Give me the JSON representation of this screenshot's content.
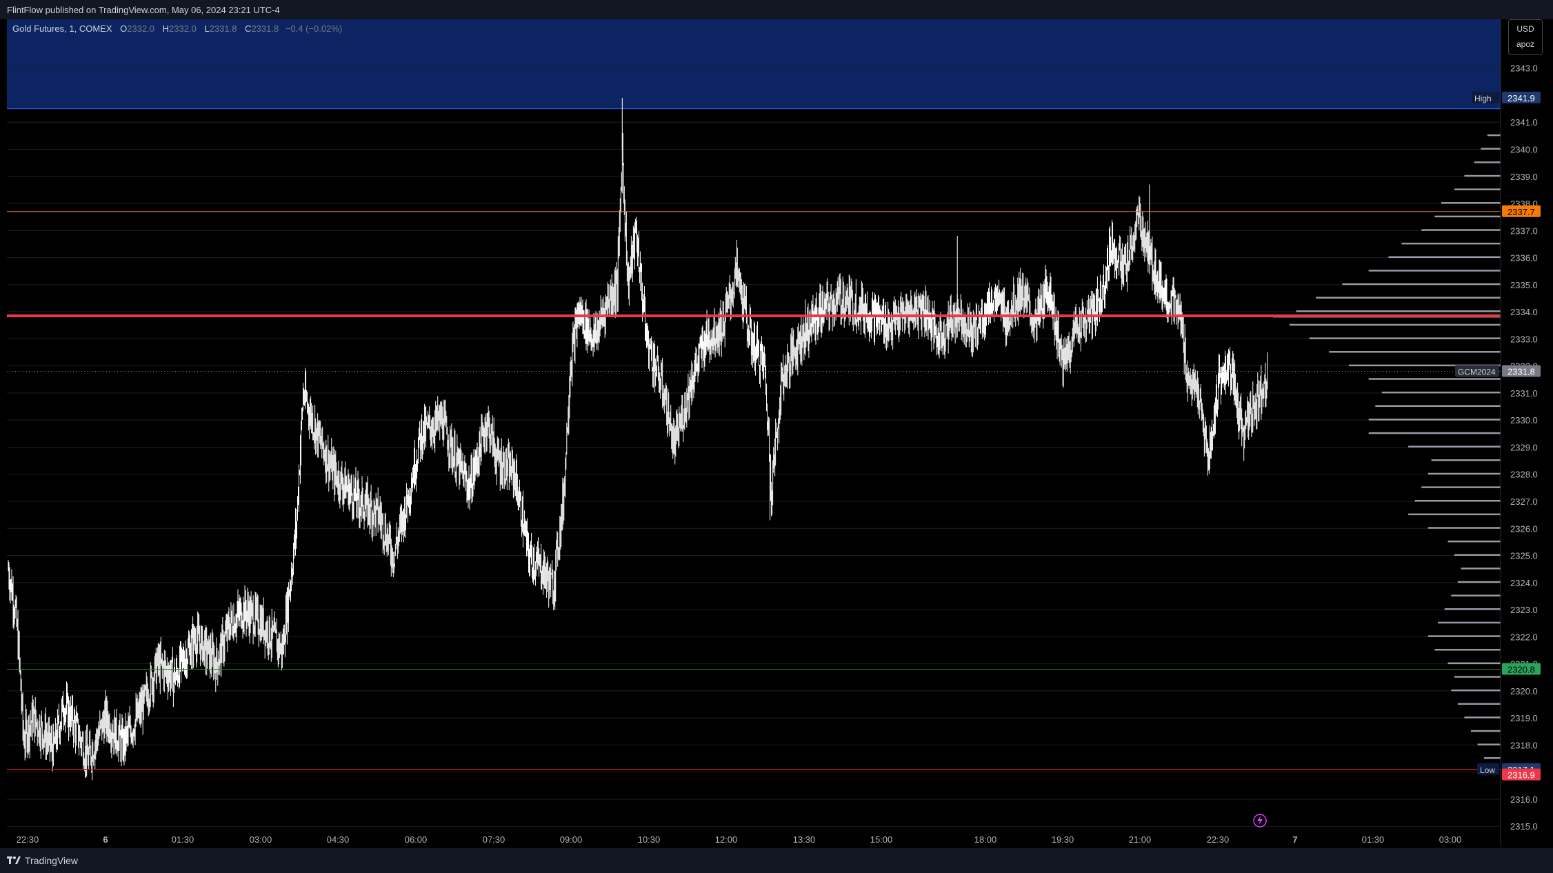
{
  "header": {
    "publish_line": "FlintFlow published on TradingView.com, May 06, 2024 23:21 UTC-4"
  },
  "legend": {
    "symbol": "Gold Futures, 1, COMEX",
    "open_label": "O",
    "open": "2332.0",
    "high_label": "H",
    "high": "2332.0",
    "low_label": "L",
    "low": "2331.8",
    "close_label": "C",
    "close": "2331.8",
    "change": "−0.4 (−0.02%)"
  },
  "scale_box": {
    "currency": "USD",
    "mode": "apoz"
  },
  "footer": {
    "brand": "TradingView"
  },
  "colors": {
    "background": "#000000",
    "premium_zone": "#0c2461",
    "premium_zone_border": "#2962ff",
    "poc_line": "#f23645",
    "upper_level": "#f57c00",
    "lower_level": "#2e7d32",
    "low_level": "#b71c1c",
    "candles": "#ffffff",
    "profile": "#b2b5be"
  },
  "icons": {
    "event_marker": "lightning-icon",
    "brand_logo": "tv-logo-icon"
  },
  "chart_data": {
    "type": "candlestick",
    "instrument": "Gold Futures",
    "timeframe": "1",
    "exchange": "COMEX",
    "ylim": [
      2314.7,
      2344.8
    ],
    "y_ticks": [
      "2315.0",
      "2316.0",
      "2317.0",
      "2318.0",
      "2319.0",
      "2320.0",
      "2321.0",
      "2322.0",
      "2323.0",
      "2324.0",
      "2325.0",
      "2326.0",
      "2327.0",
      "2328.0",
      "2329.0",
      "2330.0",
      "2331.0",
      "2332.0",
      "2333.0",
      "2334.0",
      "2335.0",
      "2336.0",
      "2337.0",
      "2338.0",
      "2339.0",
      "2340.0",
      "2341.0",
      "2343.0"
    ],
    "x_ticks": [
      "22:30",
      "6",
      "01:30",
      "03:00",
      "04:30",
      "06:00",
      "07:30",
      "09:00",
      "10:30",
      "12:00",
      "13:30",
      "15:00",
      "18:00",
      "19:30",
      "21:00",
      "22:30",
      "7",
      "01:30",
      "03:00"
    ],
    "price_path": [
      [
        0,
        2324.5
      ],
      [
        10,
        2323.0
      ],
      [
        15,
        2321.5
      ],
      [
        22,
        2318.2
      ],
      [
        35,
        2319.0
      ],
      [
        50,
        2318.5
      ],
      [
        65,
        2317.8
      ],
      [
        80,
        2319.5
      ],
      [
        95,
        2318.8
      ],
      [
        115,
        2317.5
      ],
      [
        140,
        2319.0
      ],
      [
        165,
        2318.0
      ],
      [
        195,
        2319.5
      ],
      [
        215,
        2321.0
      ],
      [
        240,
        2320.5
      ],
      [
        270,
        2322.0
      ],
      [
        300,
        2321.0
      ],
      [
        320,
        2322.5
      ],
      [
        340,
        2323.0
      ],
      [
        365,
        2322.5
      ],
      [
        395,
        2321.5
      ],
      [
        415,
        2326.0
      ],
      [
        425,
        2331.0
      ],
      [
        445,
        2329.5
      ],
      [
        470,
        2328.0
      ],
      [
        505,
        2327.0
      ],
      [
        535,
        2326.5
      ],
      [
        555,
        2325.0
      ],
      [
        575,
        2327.0
      ],
      [
        595,
        2329.5
      ],
      [
        625,
        2330.0
      ],
      [
        645,
        2328.5
      ],
      [
        665,
        2327.5
      ],
      [
        690,
        2330.0
      ],
      [
        705,
        2328.5
      ],
      [
        730,
        2328.0
      ],
      [
        750,
        2325.0
      ],
      [
        770,
        2324.5
      ],
      [
        785,
        2323.8
      ],
      [
        800,
        2327.0
      ],
      [
        810,
        2332.0
      ],
      [
        822,
        2334.0
      ],
      [
        845,
        2333.0
      ],
      [
        865,
        2334.5
      ],
      [
        878,
        2335.0
      ],
      [
        885,
        2340.0
      ],
      [
        893,
        2335.0
      ],
      [
        905,
        2337.0
      ],
      [
        920,
        2333.0
      ],
      [
        945,
        2331.0
      ],
      [
        960,
        2329.0
      ],
      [
        985,
        2331.5
      ],
      [
        1005,
        2333.0
      ],
      [
        1030,
        2333.5
      ],
      [
        1050,
        2335.5
      ],
      [
        1070,
        2333.0
      ],
      [
        1090,
        2332.0
      ],
      [
        1100,
        2327.5
      ],
      [
        1115,
        2331.5
      ],
      [
        1140,
        2333.0
      ],
      [
        1170,
        2334.0
      ],
      [
        1200,
        2334.5
      ],
      [
        1240,
        2334.0
      ],
      [
        1270,
        2333.5
      ],
      [
        1300,
        2334.0
      ],
      [
        1320,
        2334.2
      ],
      [
        1340,
        2333.0
      ],
      [
        1370,
        2334.0
      ],
      [
        1390,
        2333.2
      ],
      [
        1420,
        2334.5
      ],
      [
        1440,
        2333.8
      ],
      [
        1460,
        2334.8
      ],
      [
        1480,
        2333.5
      ],
      [
        1500,
        2335.0
      ],
      [
        1520,
        2332.0
      ],
      [
        1540,
        2333.5
      ],
      [
        1560,
        2333.8
      ],
      [
        1575,
        2334.5
      ],
      [
        1590,
        2336.5
      ],
      [
        1610,
        2335.5
      ],
      [
        1630,
        2337.5
      ],
      [
        1645,
        2336.0
      ],
      [
        1660,
        2335.0
      ],
      [
        1690,
        2333.8
      ],
      [
        1700,
        2331.5
      ],
      [
        1715,
        2331.0
      ],
      [
        1730,
        2328.5
      ],
      [
        1745,
        2331.5
      ],
      [
        1760,
        2332.0
      ],
      [
        1780,
        2329.5
      ],
      [
        1795,
        2330.5
      ],
      [
        1805,
        2331.0
      ],
      [
        1815,
        2331.8
      ]
    ],
    "profile": [
      [
        2317.5,
        25
      ],
      [
        2318.0,
        35
      ],
      [
        2318.5,
        45
      ],
      [
        2319.0,
        55
      ],
      [
        2319.5,
        65
      ],
      [
        2320.0,
        75
      ],
      [
        2320.5,
        70
      ],
      [
        2321.0,
        80
      ],
      [
        2321.5,
        100
      ],
      [
        2322.0,
        110
      ],
      [
        2322.5,
        95
      ],
      [
        2323.0,
        85
      ],
      [
        2323.5,
        75
      ],
      [
        2324.0,
        65
      ],
      [
        2324.5,
        60
      ],
      [
        2325.0,
        70
      ],
      [
        2325.5,
        80
      ],
      [
        2326.0,
        110
      ],
      [
        2326.5,
        140
      ],
      [
        2327.0,
        130
      ],
      [
        2327.5,
        120
      ],
      [
        2328.0,
        110
      ],
      [
        2328.5,
        105
      ],
      [
        2329.0,
        140
      ],
      [
        2329.5,
        200
      ],
      [
        2330.0,
        200
      ],
      [
        2330.5,
        190
      ],
      [
        2331.0,
        180
      ],
      [
        2331.5,
        200
      ],
      [
        2332.0,
        230
      ],
      [
        2332.5,
        260
      ],
      [
        2333.0,
        290
      ],
      [
        2333.5,
        320
      ],
      [
        2333.8,
        345
      ],
      [
        2334.0,
        310
      ],
      [
        2334.5,
        280
      ],
      [
        2335.0,
        240
      ],
      [
        2335.5,
        200
      ],
      [
        2336.0,
        170
      ],
      [
        2336.5,
        150
      ],
      [
        2337.0,
        120
      ],
      [
        2337.5,
        100
      ],
      [
        2338.0,
        90
      ],
      [
        2338.5,
        70
      ],
      [
        2339.0,
        55
      ],
      [
        2339.5,
        40
      ],
      [
        2340.0,
        30
      ],
      [
        2340.5,
        20
      ]
    ],
    "levels": {
      "premium_zone": [
        2341.5,
        2345.0
      ],
      "poc": 2333.85,
      "upper": 2337.7,
      "lower": 2320.8,
      "low": 2317.1,
      "current": 2331.8
    },
    "price_labels": [
      {
        "text": "2341.9",
        "tag": "High",
        "value": 2341.9,
        "bg": "#1e3a6e",
        "fg": "#ffffff"
      },
      {
        "text": "2337.7",
        "tag": "",
        "value": 2337.7,
        "bg": "#f57c00",
        "fg": "#000000"
      },
      {
        "text": "2331.8",
        "tag": "GCM2024",
        "value": 2331.8,
        "bg": "#787b86",
        "fg": "#ffffff"
      },
      {
        "text": "2320.8",
        "tag": "",
        "value": 2320.8,
        "bg": "#26a65b",
        "fg": "#000000"
      },
      {
        "text": "2317.1",
        "tag": "Low",
        "value": 2317.1,
        "bg": "#1e3a6e",
        "fg": "#ffffff"
      },
      {
        "text": "2316.9",
        "tag": "",
        "value": 2316.9,
        "bg": "#f23645",
        "fg": "#ffffff"
      }
    ]
  }
}
